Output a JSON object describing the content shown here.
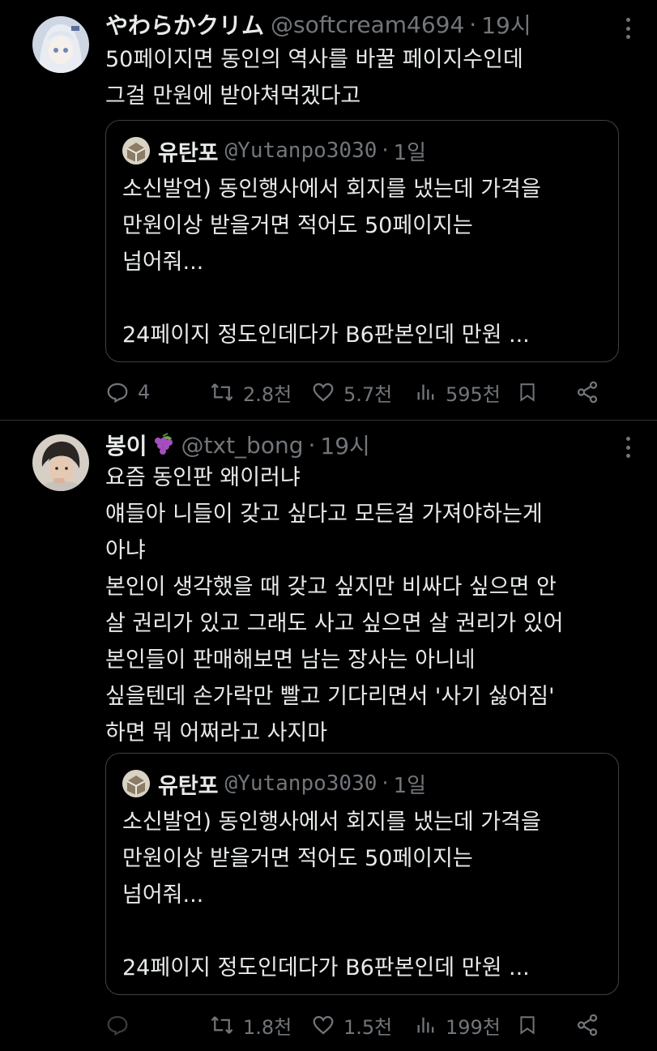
{
  "tweets": [
    {
      "name": "やわらかクリム",
      "handle": "@softcream4694",
      "time": "19시",
      "lines": [
        "50페이지면 동인의 역사를 바꿀 페이지수인데",
        "그걸 만원에 받아쳐먹겠다고"
      ],
      "quote": {
        "name": "유탄포",
        "handle": "@Yutanpo3030",
        "time": "1일",
        "lines": [
          "소신발언) 동인행사에서 회지를 냈는데 가격을",
          "만원이상 받을거면 적어도 50페이지는",
          "넘어줘...",
          "",
          "24페이지 정도인데다가 B6판본인데 만원 ..."
        ]
      },
      "stats": {
        "replies": "4",
        "retweets": "2.8천",
        "likes": "5.7천",
        "views": "595천"
      }
    },
    {
      "name": "봉이",
      "handle": "@txt_bong",
      "time": "19시",
      "lines": [
        "요즘 동인판 왜이러냐",
        "얘들아 니들이 갖고 싶다고 모든걸 가져야하는게",
        "아냐",
        "본인이 생각했을 때 갖고 싶지만 비싸다 싶으면 안",
        "살 권리가 있고 그래도 사고 싶으면 살 권리가 있어",
        "본인들이 판매해보면 남는 장사는 아니네",
        "싶을텐데 손가락만 빨고 기다리면서 '사기 싫어짐'",
        "하면 뭐 어쩌라고 사지마"
      ],
      "quote": {
        "name": "유탄포",
        "handle": "@Yutanpo3030",
        "time": "1일",
        "lines": [
          "소신발언) 동인행사에서 회지를 냈는데 가격을",
          "만원이상 받을거면 적어도 50페이지는",
          "넘어줘...",
          "",
          "24페이지 정도인데다가 B6판본인데 만원 ..."
        ]
      },
      "stats": {
        "replies": "",
        "retweets": "1.8천",
        "likes": "1.5천",
        "views": "199천"
      }
    }
  ],
  "colors": {
    "background": "#000000",
    "text": "#e7e9ea",
    "muted": "#71767b",
    "border": "#3e4144"
  },
  "icons": [
    "reply-icon",
    "retweet-icon",
    "like-icon",
    "views-icon",
    "bookmark-icon",
    "share-icon",
    "more-icon"
  ]
}
